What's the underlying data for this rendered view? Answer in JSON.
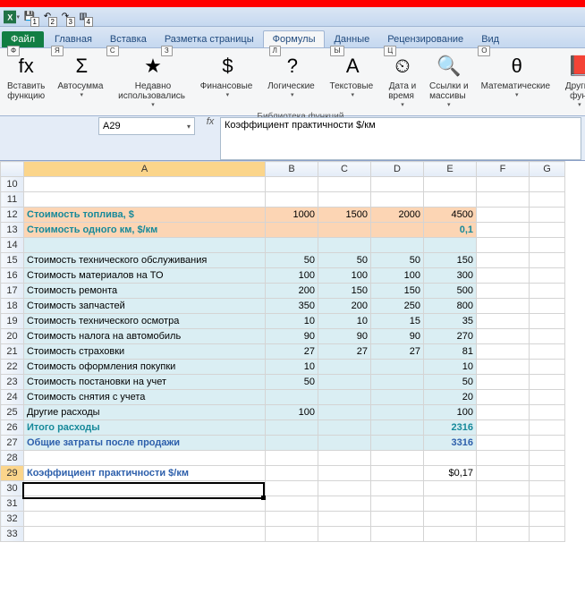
{
  "qat": {
    "badges": [
      "1",
      "2",
      "3",
      "4"
    ]
  },
  "tabs": {
    "file": "Файл",
    "items": [
      "Главная",
      "Вставка",
      "Разметка страницы",
      "Формулы",
      "Данные",
      "Рецензирование",
      "Вид"
    ],
    "keys": [
      "Ф",
      "Я",
      "С",
      "З",
      "Л",
      "Ы",
      "Ц",
      "О"
    ],
    "active_index": 3
  },
  "ribbon": {
    "group_label": "Библиотека функций",
    "buttons": [
      {
        "label": "Вставить\nфункцию",
        "icon": "fx"
      },
      {
        "label": "Автосумма",
        "icon": "Σ",
        "dd": true
      },
      {
        "label": "Недавно\nиспользовались",
        "icon": "★",
        "dd": true
      },
      {
        "label": "Финансовые",
        "icon": "$",
        "dd": true
      },
      {
        "label": "Логические",
        "icon": "?",
        "dd": true
      },
      {
        "label": "Текстовые",
        "icon": "A",
        "dd": true
      },
      {
        "label": "Дата и\nвремя",
        "icon": "⏲",
        "dd": true
      },
      {
        "label": "Ссылки и\nмассивы",
        "icon": "🔍",
        "dd": true
      },
      {
        "label": "Математические",
        "icon": "θ",
        "dd": true
      },
      {
        "label": "Другие\nфун",
        "icon": "📕",
        "dd": true
      }
    ]
  },
  "namebox": "A29",
  "formula": "Коэффициент практичности $/км",
  "columns": [
    "A",
    "B",
    "C",
    "D",
    "E",
    "F",
    "G"
  ],
  "rows": [
    {
      "n": 10,
      "cells": [
        "",
        "",
        "",
        "",
        "",
        ""
      ],
      "cls": []
    },
    {
      "n": 11,
      "cells": [
        "",
        "",
        "",
        "",
        "",
        ""
      ],
      "cls": []
    },
    {
      "n": 12,
      "cells": [
        "Стоимость топлива, $",
        "1000",
        "1500",
        "2000",
        "4500",
        ""
      ],
      "cls": [
        "fill-orange txt-bold-teal",
        "fill-orange num",
        "fill-orange num",
        "fill-orange num",
        "fill-orange num",
        ""
      ]
    },
    {
      "n": 13,
      "cells": [
        "Стоимость одного км, $/км",
        "",
        "",
        "",
        "0,1",
        ""
      ],
      "cls": [
        "fill-orange txt-bold-teal",
        "fill-orange",
        "fill-orange",
        "fill-orange",
        "fill-orange num txt-bold-teal",
        ""
      ]
    },
    {
      "n": 14,
      "cells": [
        "",
        "",
        "",
        "",
        "",
        ""
      ],
      "cls": [
        "fill-blue",
        "fill-blue",
        "fill-blue",
        "fill-blue",
        "fill-blue",
        ""
      ]
    },
    {
      "n": 15,
      "cells": [
        "Стоимость технического обслуживания",
        "50",
        "50",
        "50",
        "150",
        ""
      ],
      "cls": [
        "fill-blue",
        "fill-blue num",
        "fill-blue num",
        "fill-blue num",
        "fill-blue num",
        ""
      ]
    },
    {
      "n": 16,
      "cells": [
        "Стоимость материалов на ТО",
        "100",
        "100",
        "100",
        "300",
        ""
      ],
      "cls": [
        "fill-blue",
        "fill-blue num",
        "fill-blue num",
        "fill-blue num",
        "fill-blue num",
        ""
      ]
    },
    {
      "n": 17,
      "cells": [
        "Стоимость ремонта",
        "200",
        "150",
        "150",
        "500",
        ""
      ],
      "cls": [
        "fill-blue",
        "fill-blue num",
        "fill-blue num",
        "fill-blue num",
        "fill-blue num",
        ""
      ]
    },
    {
      "n": 18,
      "cells": [
        "Стоимость запчастей",
        "350",
        "200",
        "250",
        "800",
        ""
      ],
      "cls": [
        "fill-blue",
        "fill-blue num",
        "fill-blue num",
        "fill-blue num",
        "fill-blue num",
        ""
      ]
    },
    {
      "n": 19,
      "cells": [
        "Стоимость технического осмотра",
        "10",
        "10",
        "15",
        "35",
        ""
      ],
      "cls": [
        "fill-blue",
        "fill-blue num",
        "fill-blue num",
        "fill-blue num",
        "fill-blue num",
        ""
      ]
    },
    {
      "n": 20,
      "cells": [
        "Стоимость налога на автомобиль",
        "90",
        "90",
        "90",
        "270",
        ""
      ],
      "cls": [
        "fill-blue",
        "fill-blue num",
        "fill-blue num",
        "fill-blue num",
        "fill-blue num",
        ""
      ]
    },
    {
      "n": 21,
      "cells": [
        "Стоимость страховки",
        "27",
        "27",
        "27",
        "81",
        ""
      ],
      "cls": [
        "fill-blue",
        "fill-blue num",
        "fill-blue num",
        "fill-blue num",
        "fill-blue num",
        ""
      ]
    },
    {
      "n": 22,
      "cells": [
        "Стоимость оформления покупки",
        "10",
        "",
        "",
        "10",
        ""
      ],
      "cls": [
        "fill-blue",
        "fill-blue num",
        "fill-blue",
        "fill-blue",
        "fill-blue num",
        ""
      ]
    },
    {
      "n": 23,
      "cells": [
        "Стоимость постановки на учет",
        "50",
        "",
        "",
        "50",
        ""
      ],
      "cls": [
        "fill-blue",
        "fill-blue num",
        "fill-blue",
        "fill-blue",
        "fill-blue num",
        ""
      ]
    },
    {
      "n": 24,
      "cells": [
        "Стоимость снятия с учета",
        "",
        "",
        "",
        "20",
        ""
      ],
      "cls": [
        "fill-blue",
        "fill-blue",
        "fill-blue",
        "fill-blue",
        "fill-blue num",
        ""
      ]
    },
    {
      "n": 25,
      "cells": [
        "Другие расходы",
        "100",
        "",
        "",
        "100",
        ""
      ],
      "cls": [
        "fill-blue",
        "fill-blue num",
        "fill-blue",
        "fill-blue",
        "fill-blue num",
        ""
      ]
    },
    {
      "n": 26,
      "cells": [
        "Итого расходы",
        "",
        "",
        "",
        "2316",
        ""
      ],
      "cls": [
        "fill-blue txt-bold-teal",
        "fill-blue",
        "fill-blue",
        "fill-blue",
        "fill-blue num txt-bold-teal",
        ""
      ]
    },
    {
      "n": 27,
      "cells": [
        "Общие затраты после продажи",
        "",
        "",
        "",
        "3316",
        ""
      ],
      "cls": [
        "fill-blue txt-bold-blue",
        "fill-blue",
        "fill-blue",
        "fill-blue",
        "fill-blue num txt-bold-blue",
        ""
      ]
    },
    {
      "n": 28,
      "cells": [
        "",
        "",
        "",
        "",
        "",
        ""
      ],
      "cls": []
    },
    {
      "n": 29,
      "cells": [
        "Коэффициент практичности $/км",
        "",
        "",
        "",
        "$0,17",
        ""
      ],
      "cls": [
        "txt-bold-blue",
        "",
        "",
        "",
        "num",
        ""
      ]
    },
    {
      "n": 30,
      "cells": [
        "",
        "",
        "",
        "",
        "",
        ""
      ],
      "cls": []
    },
    {
      "n": 31,
      "cells": [
        "",
        "",
        "",
        "",
        "",
        ""
      ],
      "cls": []
    },
    {
      "n": 32,
      "cells": [
        "",
        "",
        "",
        "",
        "",
        ""
      ],
      "cls": []
    },
    {
      "n": 33,
      "cells": [
        "",
        "",
        "",
        "",
        "",
        ""
      ],
      "cls": []
    }
  ],
  "active": {
    "row": 29,
    "col": "A"
  }
}
